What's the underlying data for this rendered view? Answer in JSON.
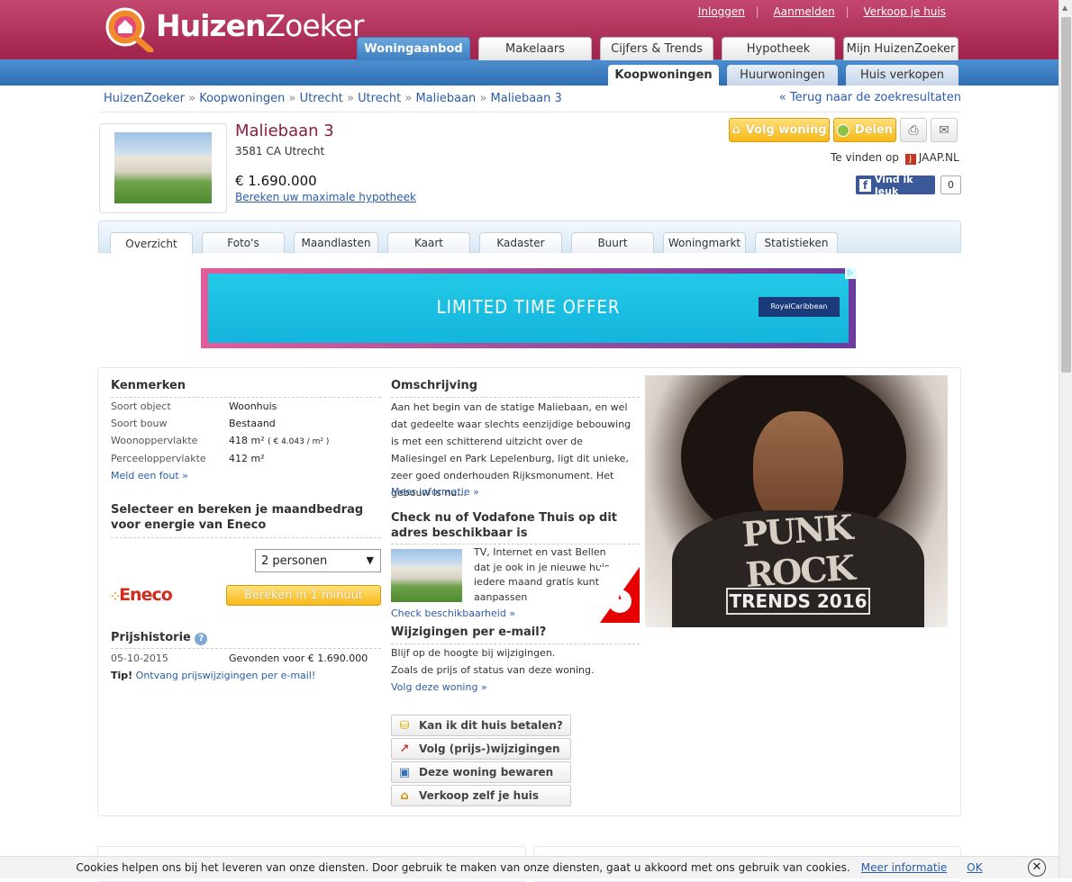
{
  "brand": {
    "name_bold": "Huizen",
    "name_light": "Zoeker"
  },
  "toplinks": {
    "login": "Inloggen",
    "register": "Aanmelden",
    "sell": "Verkoop je huis"
  },
  "maintabs": [
    {
      "label": "Woningaanbod"
    },
    {
      "label": "Makelaars"
    },
    {
      "label": "Cijfers & Trends"
    },
    {
      "label": "Hypotheek"
    },
    {
      "label": "Mijn HuizenZoeker"
    }
  ],
  "subtabs": [
    {
      "label": "Koopwoningen"
    },
    {
      "label": "Huurwoningen"
    },
    {
      "label": "Huis verkopen"
    }
  ],
  "breadcrumb": [
    "HuizenZoeker",
    "Koopwoningen",
    "Utrecht",
    "Utrecht",
    "Maliebaan",
    "Maliebaan 3"
  ],
  "breadcrumb_sep": "»",
  "back_link": "« Terug naar de zoekresultaten",
  "listing": {
    "title": "Maliebaan 3",
    "address": "3581 CA Utrecht",
    "price": "€ 1.690.000",
    "mortgage_link": "Bereken uw maximale hypotheek"
  },
  "actions": {
    "follow": "Volg woning",
    "share": "Delen"
  },
  "found_on": {
    "label": "Te vinden op",
    "site": "JAAP.NL"
  },
  "facebook": {
    "label": "Vind ik leuk",
    "count": "0"
  },
  "detail_tabs": [
    {
      "label": "Overzicht"
    },
    {
      "label": "Foto's"
    },
    {
      "label": "Maandlasten"
    },
    {
      "label": "Kaart"
    },
    {
      "label": "Kadaster"
    },
    {
      "label": "Buurt"
    },
    {
      "label": "Woningmarkt"
    },
    {
      "label": "Statistieken"
    }
  ],
  "ad_banner": {
    "text": "LIMITED TIME OFFER",
    "brand": "RoyalCaribbean"
  },
  "kenmerken": {
    "heading": "Kenmerken",
    "rows": [
      {
        "label": "Soort object",
        "value": "Woonhuis"
      },
      {
        "label": "Soort bouw",
        "value": "Bestaand"
      },
      {
        "label": "Woonoppervlakte",
        "value": "418 m²",
        "extra": "( € 4.043 / m² )"
      },
      {
        "label": "Perceeloppervlakte",
        "value": "412 m²"
      }
    ],
    "report_link": "Meld een fout »"
  },
  "energy": {
    "heading": "Selecteer en bereken je maandbedrag voor energie van Eneco",
    "select_value": "2 personen",
    "brand": "Eneco",
    "button": "Bereken in 1 minuut"
  },
  "prijshistorie": {
    "heading": "Prijshistorie",
    "date": "05-10-2015",
    "event": "Gevonden voor € 1.690.000",
    "tip_label": "Tip!",
    "tip_link": "Ontvang prijswijzigingen per e-mail!"
  },
  "omschrijving": {
    "heading": "Omschrijving",
    "text": "Aan het begin van de statige Maliebaan, en wel dat gedeelte waar slechts eenzijdige bebouwing is met een schitterend uitzicht over de Maliesingel en Park Lepelenburg, ligt dit unieke, zeer goed onderhouden Rijksmonument. Het gebouw is nu...",
    "more": "Meer informatie »"
  },
  "vodafone": {
    "heading": "Check nu of Vodafone Thuis op dit adres beschikbaar is",
    "text": "TV, Internet en vast Bellen dat je ook in je nieuwe huis iedere maand gratis kunt aanpassen",
    "link": "Check beschikbaarheid »"
  },
  "email": {
    "heading": "Wijzigingen per e-mail?",
    "line1": "Blijf op de hoogte bij wijzigingen.",
    "line2": "Zoals de prijs of status van deze woning.",
    "link": "Volg deze woning »"
  },
  "action_buttons": [
    {
      "label": "Kan ik dit huis betalen?"
    },
    {
      "label": "Volg (prijs-)wijzigingen"
    },
    {
      "label": "Deze woning bewaren"
    },
    {
      "label": "Verkoop zelf je huis"
    }
  ],
  "side_ad": {
    "line1": "PUNK ROCK",
    "line2": "TRENDS 2016"
  },
  "cookie": {
    "text": "Cookies helpen ons bij het leveren van onze diensten. Door gebruik te maken van onze diensten, gaat u akkoord met ons gebruik van cookies.",
    "more": "Meer informatie",
    "ok": "OK"
  }
}
